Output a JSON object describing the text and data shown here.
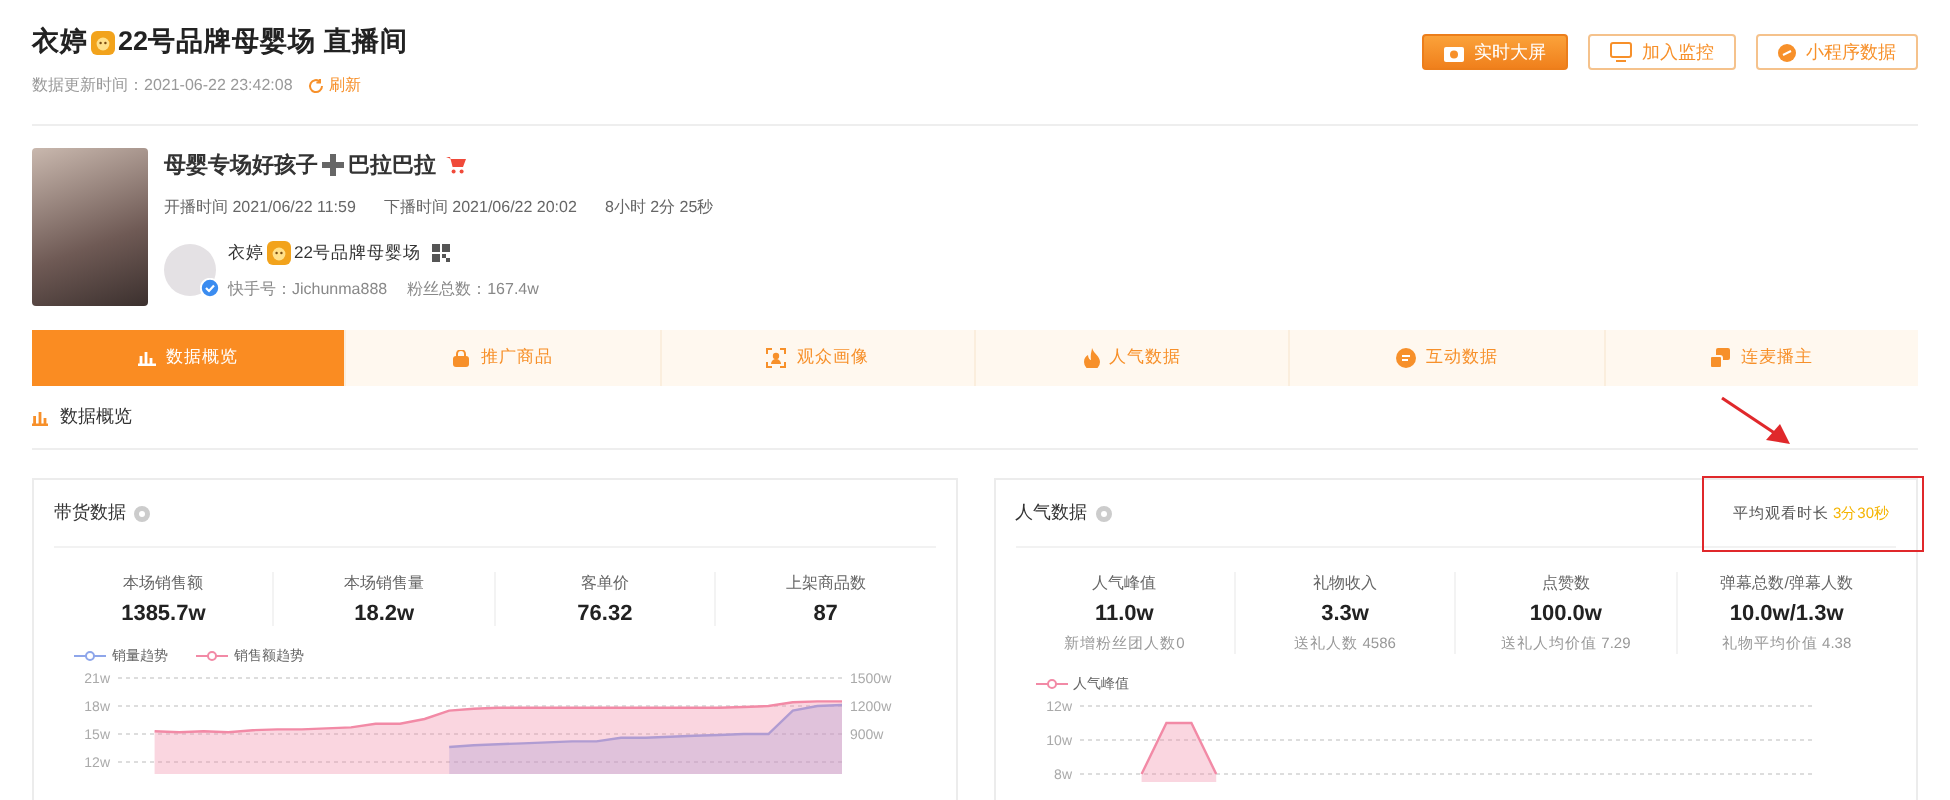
{
  "header": {
    "title_parts": [
      "衣婷",
      "22号品牌母婴场 直播间"
    ],
    "update_time": "数据更新时间：2021-06-22 23:42:08",
    "refresh": "刷新",
    "buttons": [
      {
        "label": "实时大屏",
        "kind": "primary"
      },
      {
        "label": "加入监控",
        "kind": "outline"
      },
      {
        "label": "小程序数据",
        "kind": "outline"
      }
    ]
  },
  "live": {
    "title_parts": [
      "母婴专场好孩子",
      "巴拉巴拉"
    ],
    "start": "开播时间 2021/06/22 11:59",
    "end": "下播时间 2021/06/22 20:02",
    "duration": "8小时 2分 25秒",
    "anchor": {
      "name_parts": [
        "衣婷",
        "22号品牌母婴场"
      ],
      "account": "快手号：Jichunma888",
      "fans": "粉丝总数：167.4w",
      "verified": true
    }
  },
  "tabs": [
    {
      "label": "数据概览",
      "selected": true
    },
    {
      "label": "推广商品",
      "selected": false
    },
    {
      "label": "观众画像",
      "selected": false
    },
    {
      "label": "人气数据",
      "selected": false
    },
    {
      "label": "互动数据",
      "selected": false
    },
    {
      "label": "连麦播主",
      "selected": false
    }
  ],
  "section_title": "数据概览",
  "cards": [
    {
      "title": "带货数据",
      "metrics": [
        {
          "label": "本场销售额",
          "value": "1385.7w"
        },
        {
          "label": "本场销售量",
          "value": "18.2w"
        },
        {
          "label": "客单价",
          "value": "76.32"
        },
        {
          "label": "上架商品数",
          "value": "87"
        }
      ],
      "chart_data": {
        "type": "area",
        "grid": true,
        "ylim": [
          12,
          21
        ],
        "y2lim": [
          600,
          1500
        ],
        "yticks": [
          {
            "value": 21,
            "label": "21w"
          },
          {
            "value": 18,
            "label": "18w"
          },
          {
            "value": 15,
            "label": "15w"
          },
          {
            "value": 12,
            "label": "12w"
          }
        ],
        "y2ticks": [
          {
            "value": 1500,
            "label": "1500w"
          },
          {
            "value": 1200,
            "label": "1200w"
          },
          {
            "value": 900,
            "label": "900w"
          }
        ],
        "series": [
          {
            "name": "销量趋势",
            "color": "#8ea6ea",
            "values": [
              null,
              null,
              null,
              null,
              null,
              null,
              null,
              null,
              null,
              null,
              null,
              null,
              null,
              13.6,
              13.8,
              13.9,
              14.0,
              14.1,
              14.2,
              14.2,
              14.6,
              14.6,
              14.7,
              14.8,
              14.9,
              15.0,
              15.0,
              17.5,
              18.0,
              18.1
            ]
          },
          {
            "name": "销售额趋势",
            "color": "#f28aa6",
            "values": [
              null,
              15.3,
              15.2,
              15.3,
              15.2,
              15.4,
              15.5,
              15.5,
              15.6,
              15.7,
              16.1,
              16.1,
              16.6,
              17.5,
              17.7,
              17.8,
              17.8,
              17.8,
              17.8,
              17.8,
              17.8,
              17.8,
              17.8,
              17.8,
              17.8,
              17.9,
              18.0,
              18.4,
              18.5,
              18.5
            ]
          }
        ]
      }
    },
    {
      "title": "人气数据",
      "highlight": {
        "label": "平均观看时长",
        "value": "3分30秒",
        "annotated": true
      },
      "metrics": [
        {
          "label": "人气峰值",
          "value": "11.0w",
          "note": "新增粉丝团人数0"
        },
        {
          "label": "礼物收入",
          "value": "3.3w",
          "note": "送礼人数 4586"
        },
        {
          "label": "点赞数",
          "value": "100.0w",
          "note": "送礼人均价值 7.29"
        },
        {
          "label": "弹幕总数/弹幕人数",
          "value": "10.0w/1.3w",
          "note": "礼物平均价值 4.38"
        }
      ],
      "chart_data": {
        "type": "area",
        "grid": true,
        "ylim": [
          8,
          12
        ],
        "yticks": [
          {
            "value": 12,
            "label": "12w"
          },
          {
            "value": 10,
            "label": "10w"
          },
          {
            "value": 8,
            "label": "8w"
          }
        ],
        "series": [
          {
            "name": "人气峰值",
            "color": "#f28aa6",
            "values": [
              null,
              null,
              8,
              11,
              11,
              8,
              null,
              null,
              null,
              null,
              null,
              null,
              null,
              null,
              null,
              null,
              null,
              null,
              null,
              null,
              null,
              null,
              null,
              null,
              null,
              null,
              null,
              null,
              null,
              null
            ]
          }
        ]
      }
    }
  ]
}
